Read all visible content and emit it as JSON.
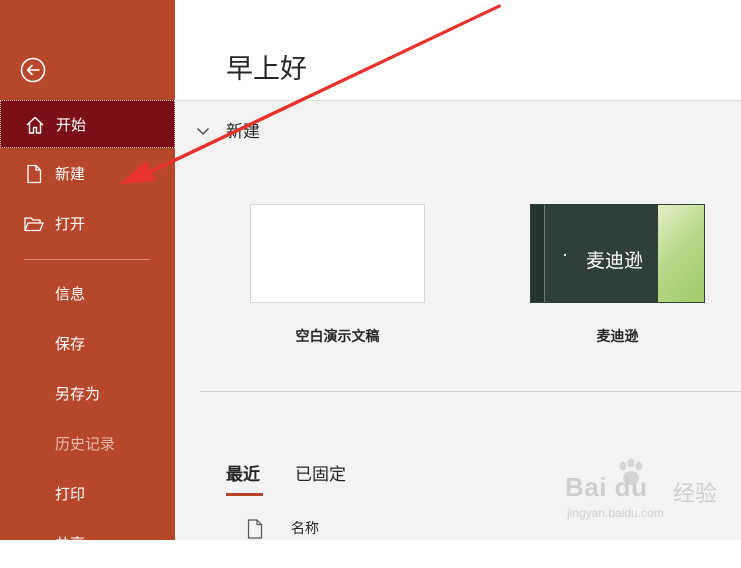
{
  "sidebar": {
    "back_icon": "arrow-left-circle-icon",
    "items": [
      {
        "label": "开始",
        "icon": "home-icon",
        "active": true
      },
      {
        "label": "新建",
        "icon": "new-document-icon"
      },
      {
        "label": "打开",
        "icon": "folder-open-icon"
      },
      {
        "label": "信息"
      },
      {
        "label": "保存"
      },
      {
        "label": "另存为"
      },
      {
        "label": "历史记录",
        "disabled": true
      },
      {
        "label": "打印"
      },
      {
        "label": "共享"
      }
    ],
    "background": "#b7472a",
    "active_background": "#7a1016"
  },
  "header": {
    "greeting": "早上好"
  },
  "new_section": {
    "toggle_icon": "chevron-down-icon",
    "title": "新建",
    "templates": [
      {
        "label": "空白演示文稿",
        "thumb_text": ""
      },
      {
        "label": "麦迪逊",
        "thumb_text": "麦迪逊"
      }
    ]
  },
  "recent": {
    "tabs": [
      {
        "label": "最近",
        "active": true
      },
      {
        "label": "已固定"
      }
    ],
    "column_icon": "file-icon",
    "column_header": "名称"
  },
  "watermark": {
    "brand": "Bai du",
    "brand_suffix": "经验",
    "url": "jingyan.baidu.com"
  },
  "annotation": {
    "arrow_color": "#e8322c"
  }
}
